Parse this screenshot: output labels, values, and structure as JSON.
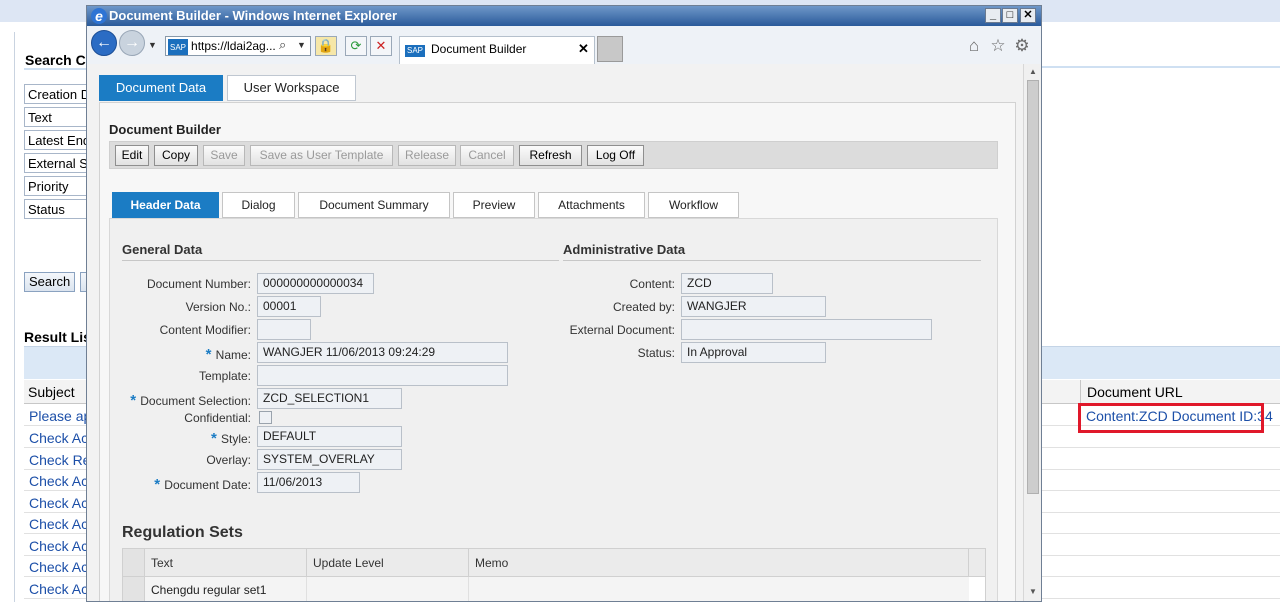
{
  "background": {
    "search_title": "Search Cr",
    "search_fields": [
      "Creation D",
      "Text",
      "Latest End",
      "External S",
      "Priority",
      "Status"
    ],
    "search_button": "Search",
    "result_title": "Result List",
    "columns": {
      "subject": "Subject",
      "document_url": "Document URL"
    },
    "rows": [
      "Please ap",
      "Check Ac",
      "Check Re",
      "Check Ac",
      "Check Ac",
      "Check Ac",
      "Check Ac",
      "Check Ac",
      "Check Ac"
    ],
    "document_url_link": "Content:ZCD Document ID:34",
    "highlight_color": "#e0182a"
  },
  "window": {
    "title": "Document Builder - Windows Internet Explorer",
    "address": "https://ldai2ag...",
    "tab_label": "Document Builder",
    "controls": {
      "minimize": "_",
      "maximize": "□",
      "close": "✕"
    }
  },
  "app": {
    "main_tabs": [
      "Document Data",
      "User Workspace"
    ],
    "heading": "Document Builder",
    "toolbar": {
      "edit": "Edit",
      "copy": "Copy",
      "save": "Save",
      "save_template": "Save as User Template",
      "release": "Release",
      "cancel": "Cancel",
      "refresh": "Refresh",
      "logoff": "Log Off"
    },
    "sub_tabs": [
      "Header Data",
      "Dialog",
      "Document Summary",
      "Preview",
      "Attachments",
      "Workflow"
    ],
    "general": {
      "title": "General Data",
      "document_number_label": "Document Number:",
      "document_number": "000000000000034",
      "version_label": "Version No.:",
      "version": "00001",
      "content_modifier_label": "Content Modifier:",
      "content_modifier": "",
      "name_label": "Name:",
      "name": "WANGJER 11/06/2013 09:24:29",
      "template_label": "Template:",
      "template": "",
      "selection_label": "Document Selection:",
      "selection": "ZCD_SELECTION1",
      "confidential_label": "Confidential:",
      "style_label": "Style:",
      "style": "DEFAULT",
      "overlay_label": "Overlay:",
      "overlay": "SYSTEM_OVERLAY",
      "date_label": "Document Date:",
      "date": "11/06/2013"
    },
    "admin": {
      "title": "Administrative Data",
      "content_label": "Content:",
      "content": "ZCD",
      "created_by_label": "Created by:",
      "created_by": "WANGJER",
      "external_label": "External Document:",
      "external": "",
      "status_label": "Status:",
      "status": "In Approval"
    },
    "regulation": {
      "title": "Regulation Sets",
      "columns": [
        "Text",
        "Update Level",
        "Memo"
      ],
      "rows": [
        {
          "text": "Chengdu regular set1",
          "update_level": "",
          "memo": ""
        }
      ]
    }
  }
}
